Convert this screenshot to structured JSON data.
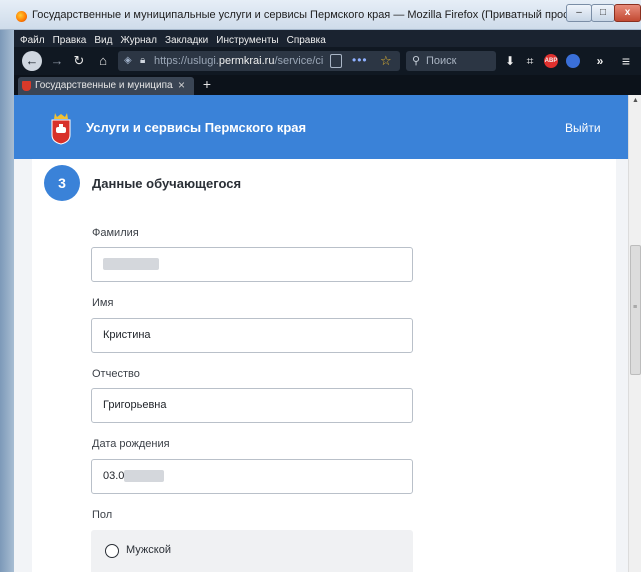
{
  "window": {
    "title": "Государственные и муниципальные услуги и сервисы Пермского края — Mozilla Firefox (Приватный просмотр)",
    "min_label": "–",
    "max_label": "□",
    "close_label": "x"
  },
  "menu": [
    "Файл",
    "Правка",
    "Вид",
    "Журнал",
    "Закладки",
    "Инструменты",
    "Справка"
  ],
  "navbar": {
    "url_prefix": "https://uslugi.",
    "url_domain": "permkrai.ru",
    "url_path": "/service/circ",
    "search_placeholder": "Поиск",
    "abp_label": "ABP"
  },
  "tabs": [
    {
      "title": "Государственные и муниципальн",
      "close": "×"
    }
  ],
  "new_tab": "+",
  "header": {
    "site_title": "Услуги и сервисы Пермского края",
    "logout": "Выйти"
  },
  "section": {
    "step": "3",
    "title": "Данные обучающегося"
  },
  "fields": {
    "surname": {
      "label": "Фамилия",
      "value": ""
    },
    "name": {
      "label": "Имя",
      "value": "Кристина"
    },
    "patronymic": {
      "label": "Отчество",
      "value": "Григорьевна"
    },
    "birthdate": {
      "label": "Дата рождения",
      "value": "03.0"
    },
    "gender": {
      "label": "Пол",
      "options": [
        "Мужской"
      ]
    }
  },
  "colors": {
    "header_blue": "#3a82d8",
    "badge_blue": "#3a82d8",
    "input_border": "#b9c0c9"
  }
}
